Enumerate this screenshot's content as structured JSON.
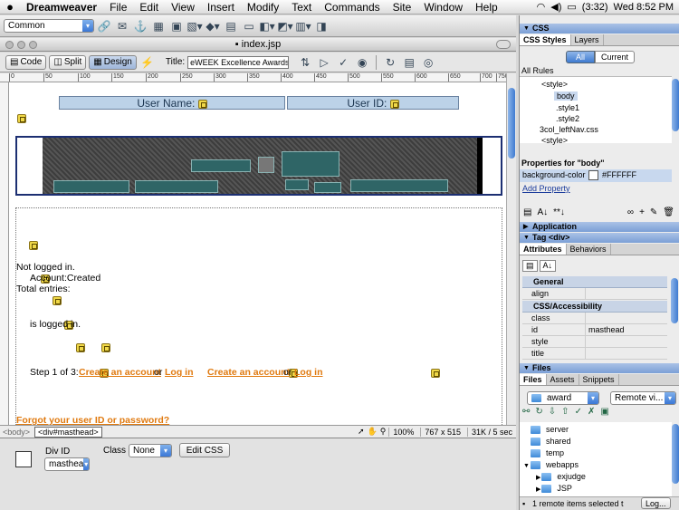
{
  "menubar": {
    "apple": "",
    "app_name": "Dreamweaver",
    "menus": [
      "File",
      "Edit",
      "View",
      "Insert",
      "Modify",
      "Text",
      "Commands",
      "Site",
      "Window",
      "Help"
    ],
    "battery": "(3:32)",
    "clock": "Wed 8:52 PM"
  },
  "insertbar": {
    "category": "Common"
  },
  "document": {
    "filename": "index.jsp",
    "view_buttons": {
      "code": "Code",
      "split": "Split",
      "design": "Design"
    },
    "title_label": "Title:",
    "title_value": "eWEEK Excellence Awards"
  },
  "ruler": {
    "marks": [
      "0",
      "50",
      "100",
      "150",
      "200",
      "250",
      "300",
      "350",
      "400",
      "450",
      "500",
      "550",
      "600",
      "650",
      "700",
      "750"
    ]
  },
  "canvas": {
    "username_label": "User Name:",
    "userid_label": "User ID:",
    "not_logged_in": "Not logged in.",
    "account_created": "Account:Created",
    "total_entries": "Total entries:",
    "is_logged_in": "is logged in.",
    "step_text": "Step 1 of 3:",
    "create_account_1": "Create an account",
    "or_1": "or",
    "login_1": "Log in",
    "create_account_2": "Create an account",
    "or_2": "or",
    "login_2": "Log in",
    "forgot": "Forgot your user ID or password?"
  },
  "statusbar": {
    "tag_body": "<body>",
    "tag_div": "<div#masthead>",
    "zoom": "100%",
    "dimensions": "767 x 515",
    "download": "31K / 5 sec"
  },
  "properties": {
    "div_id_label": "Div ID",
    "div_id_value": "masthea",
    "class_label": "Class",
    "class_value": "None",
    "edit_css": "Edit CSS"
  },
  "css_panel": {
    "title": "CSS",
    "tabs": [
      "CSS Styles",
      "Layers"
    ],
    "mode_all": "All",
    "mode_current": "Current",
    "all_rules": "All Rules",
    "rules": [
      "<style>",
      "body",
      ".style1",
      ".style2",
      "3col_leftNav.css",
      "<style>"
    ],
    "props_for": "Properties for \"body\"",
    "prop_name": "background-color",
    "prop_value": "#FFFFFF",
    "add_property": "Add Property"
  },
  "application_panel": {
    "title": "Application"
  },
  "tag_panel": {
    "title": "Tag <div>",
    "tabs": [
      "Attributes",
      "Behaviors"
    ],
    "general": "General",
    "align": "align",
    "css_access": "CSS/Accessibility",
    "attrs": [
      {
        "k": "class",
        "v": ""
      },
      {
        "k": "id",
        "v": "masthead"
      },
      {
        "k": "style",
        "v": ""
      },
      {
        "k": "title",
        "v": ""
      }
    ]
  },
  "files_panel": {
    "title": "Files",
    "tabs": [
      "Files",
      "Assets",
      "Snippets"
    ],
    "site": "award",
    "view": "Remote vi...",
    "items": [
      "server",
      "shared",
      "temp",
      "webapps",
      "exjudge",
      "JSP"
    ],
    "status": "1 remote items selected t",
    "log_button": "Log..."
  }
}
